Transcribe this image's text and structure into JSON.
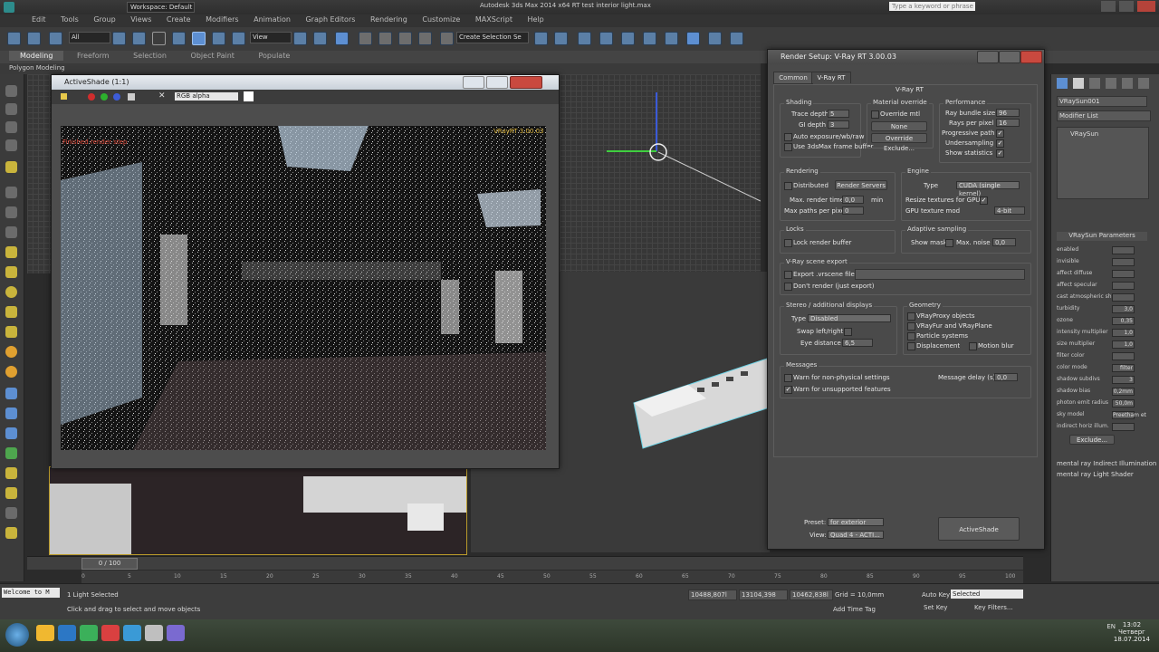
{
  "app": {
    "title": "Autodesk 3ds Max  2014 x64     RT test interior light.max",
    "workspace": "Workspace: Default",
    "search_placeholder": "Type a keyword or phrase",
    "menu": [
      "Edit",
      "Tools",
      "Group",
      "Views",
      "Create",
      "Modifiers",
      "Animation",
      "Graph Editors",
      "Rendering",
      "Customize",
      "MAXScript",
      "Help"
    ],
    "toolbar_selection_filter": "All",
    "toolbar_view": "View",
    "toolbar_named_selection": "Create Selection Se",
    "ribbon_tabs": [
      "Modeling",
      "Freeform",
      "Selection",
      "Object Paint",
      "Populate"
    ],
    "ribbon_sub": "Polygon Modeling"
  },
  "activeshade": {
    "title": "ActiveShade (1:1)",
    "channel": "RGB alpha",
    "overlay_lines": [
      "Finished render step",
      "VRayRT 3.00.03"
    ]
  },
  "render_setup": {
    "title": "Render Setup: V-Ray RT 3.00.03",
    "tabs": [
      "Common",
      "V-Ray RT"
    ],
    "rollout": "V-Ray RT",
    "shading": {
      "label": "Shading",
      "trace_depth_label": "Trace depth",
      "trace_depth": "5",
      "gi_depth_label": "GI depth",
      "gi_depth": "3",
      "auto_exposure": "Auto exposure/wb/raw",
      "use_3dsmax_fb": "Use 3dsMax frame buffer"
    },
    "material_override": {
      "label": "Material override",
      "override_mtl": "Override mtl",
      "none_btn": "None",
      "override_exclude": "Override Exclude..."
    },
    "performance": {
      "label": "Performance",
      "ray_bundle_label": "Ray bundle size",
      "ray_bundle": "96",
      "rays_per_pixel_label": "Rays per pixel",
      "rays_per_pixel": "16",
      "progressive_label": "Progressive path",
      "undersampling_label": "Undersampling",
      "show_statistics_label": "Show statistics"
    },
    "rendering": {
      "label": "Rendering",
      "distributed": "Distributed",
      "render_servers": "Render Servers",
      "max_render_time_label": "Max. render time",
      "max_render_time": "0,0",
      "min_label": "min",
      "max_paths_label": "Max paths per pixel",
      "max_paths": "0"
    },
    "engine": {
      "label": "Engine",
      "type_label": "Type",
      "type_value": "CUDA (single kernel)",
      "textures_label": "Resize textures for GPU",
      "gpu_texture_label": "GPU texture mod",
      "gpu_texture_value": "4-bit"
    },
    "lock": {
      "label": "Locks",
      "lock_render_buffer": "Lock render buffer"
    },
    "adaptive": {
      "label": "Adaptive sampling",
      "show_mask": "Show mask",
      "max_noise_label": "Max. noise",
      "max_noise": "0,0"
    },
    "vrscene": {
      "label": "V-Ray scene export",
      "export": "Export .vrscene file",
      "dont_render": "Don't render (just export)"
    },
    "stereo": {
      "label": "Stereo / additional displays",
      "type_label": "Type",
      "type_value": "Disabled",
      "swap_label": "Swap left/right",
      "eye_distance_label": "Eye distance",
      "eye_distance": "6,5"
    },
    "geometry": {
      "label": "Geometry",
      "vraymesh": "VRayProxy objects",
      "vrayfur": "VRayFur and VRayPlane",
      "particle": "Particle systems",
      "displacement": "Displacement",
      "motion_blur": "Motion blur"
    },
    "messages": {
      "label": "Messages",
      "warn_nonphysical": "Warn for non-physical settings",
      "warn_unsupported": "Warn for unsupported features",
      "msg_delay_label": "Message delay (s)",
      "msg_delay": "0,0"
    },
    "footer": {
      "preset_label": "Preset:",
      "preset_value": "for exterior",
      "view_label": "View:",
      "view_value": "Quad 4 - ACTI...",
      "activeshade_btn": "ActiveShade"
    }
  },
  "command_panel": {
    "object_name": "VRaySun001",
    "modifier_list": "Modifier List",
    "stack_item": "VRaySun",
    "rollout": "VRaySun Parameters",
    "params": [
      {
        "label": "enabled",
        "value": ""
      },
      {
        "label": "invisible",
        "value": ""
      },
      {
        "label": "affect diffuse",
        "value": ""
      },
      {
        "label": "affect specular",
        "value": ""
      },
      {
        "label": "cast atmospheric shadows",
        "value": ""
      },
      {
        "label": "turbidity",
        "value": "3,0"
      },
      {
        "label": "ozone",
        "value": "0,35"
      },
      {
        "label": "intensity multiplier",
        "value": "1,0"
      },
      {
        "label": "size multiplier",
        "value": "1,0"
      },
      {
        "label": "filter color",
        "value": ""
      },
      {
        "label": "color mode",
        "value": "filter"
      },
      {
        "label": "shadow subdivs",
        "value": "3"
      },
      {
        "label": "shadow bias",
        "value": "0,2mm"
      },
      {
        "label": "photon emit radius",
        "value": "50,0m"
      },
      {
        "label": "sky model",
        "value": "Preetham et"
      },
      {
        "label": "indirect horiz illum.",
        "value": ""
      }
    ],
    "exclude_btn": "Exclude...",
    "mr_rollouts": [
      "mental ray Indirect Illumination",
      "mental ray Light Shader"
    ]
  },
  "timeline": {
    "frame": "0 / 100",
    "ticks": [
      "0",
      "5",
      "10",
      "15",
      "20",
      "25",
      "30",
      "35",
      "40",
      "45",
      "50",
      "55",
      "60",
      "65",
      "70",
      "75",
      "80",
      "85",
      "90",
      "95",
      "100"
    ]
  },
  "status": {
    "listener": "Welcome to M",
    "selection": "1 Light Selected",
    "prompt": "Click and drag to select and move objects",
    "x": "10488,807l",
    "y": "13104,398",
    "z": "10462,838l",
    "grid": "Grid = 10,0mm",
    "autokey": "Auto Key",
    "setkey": "Set Key",
    "selected": "Selected",
    "key_filters": "Key Filters...",
    "add_time_tag": "Add Time Tag"
  },
  "taskbar": {
    "lang": "EN",
    "time": "13:02",
    "day": "Четверг",
    "date": "18.07.2014"
  }
}
